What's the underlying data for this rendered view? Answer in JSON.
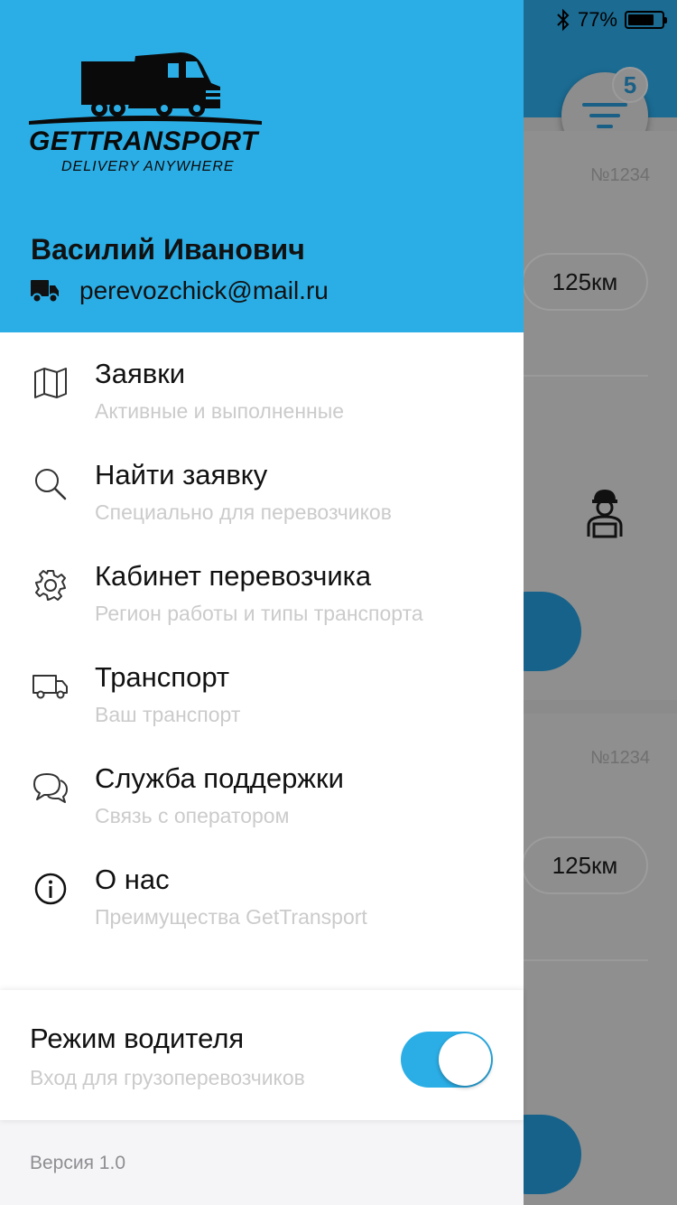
{
  "status_bar": {
    "battery": "77%",
    "battery_level": 0.77
  },
  "background": {
    "filter_badge": "5",
    "cards": [
      {
        "number": "№1234",
        "distance": "125км"
      },
      {
        "number": "№1234",
        "distance": "125км"
      }
    ]
  },
  "drawer": {
    "logo": {
      "title": "GETTRANSPORT",
      "subtitle": "DELIVERY ANYWHERE"
    },
    "user": {
      "name": "Василий Иванович",
      "email": "perevozchick@mail.ru"
    },
    "menu": [
      {
        "icon": "map-icon",
        "title": "Заявки",
        "subtitle": "Активные и выполненные"
      },
      {
        "icon": "search-icon",
        "title": "Найти заявку",
        "subtitle": "Специально для перевозчиков"
      },
      {
        "icon": "gear-icon",
        "title": "Кабинет перевозчика",
        "subtitle": "Регион работы и типы транспорта"
      },
      {
        "icon": "truck-icon",
        "title": "Транспорт",
        "subtitle": "Ваш транспорт"
      },
      {
        "icon": "chat-icon",
        "title": "Служба поддержки",
        "subtitle": "Связь с оператором"
      },
      {
        "icon": "info-icon",
        "title": "О нас",
        "subtitle": "Преимущества GetTransport"
      }
    ],
    "driver_mode": {
      "title": "Режим водителя",
      "subtitle": "Вход для грузоперевозчиков",
      "enabled": true
    },
    "version": "Версия 1.0"
  },
  "colors": {
    "accent": "#2baee6",
    "text": "#111111",
    "muted": "#cbcbcb"
  }
}
